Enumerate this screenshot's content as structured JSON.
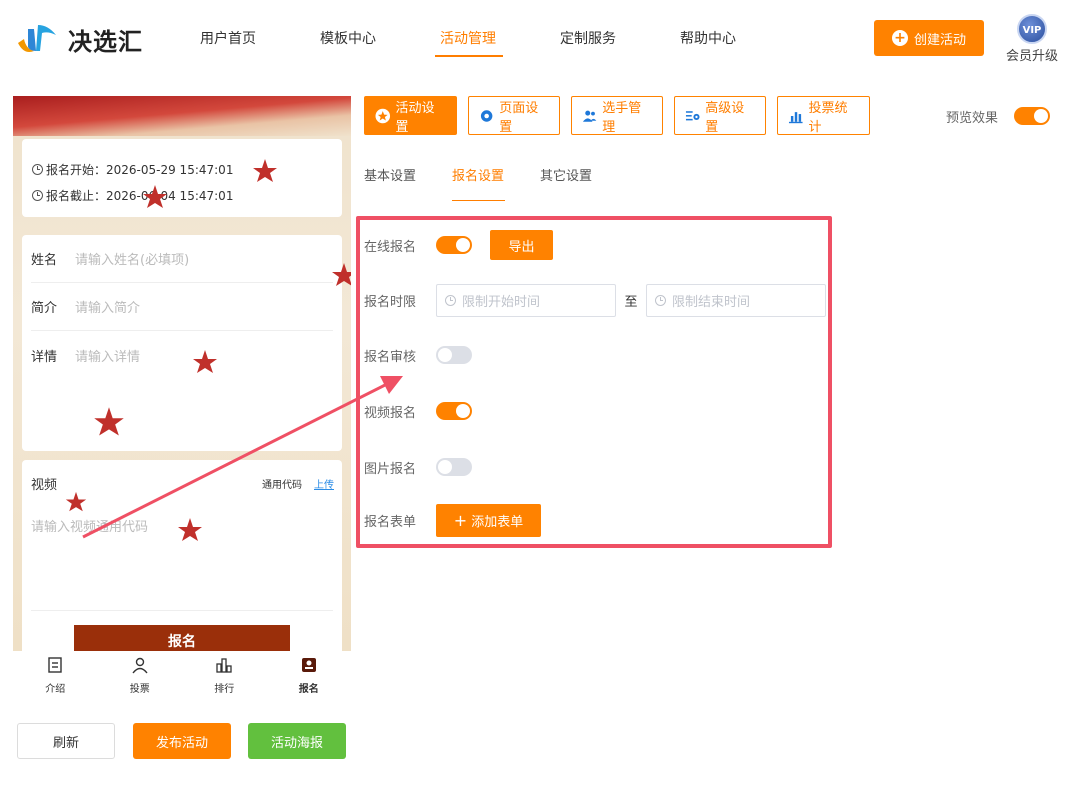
{
  "app": {
    "logo_text": "决选汇",
    "nav": [
      "用户首页",
      "模板中心",
      "活动管理",
      "定制服务",
      "帮助中心"
    ],
    "active_nav": "活动管理",
    "create_button": "创建活动",
    "vip_badge": "VIP",
    "vip_label": "会员升级"
  },
  "preview": {
    "times": {
      "start": "报名开始：2026-05-29 15:47:01",
      "end": "报名截止：2026-06-04 15:47:01"
    },
    "fields": [
      {
        "label": "姓名",
        "placeholder": "请输入姓名(必填项)"
      },
      {
        "label": "简介",
        "placeholder": "请输入简介"
      },
      {
        "label": "详情",
        "placeholder": "请输入详情"
      }
    ],
    "video": {
      "title": "视频",
      "code_label": "通用代码",
      "upload_label": "上传",
      "placeholder": "请输入视频通用代码"
    },
    "submit_label": "报名",
    "tabbar": [
      {
        "label": "介绍",
        "icon": "document-icon"
      },
      {
        "label": "投票",
        "icon": "user-icon"
      },
      {
        "label": "排行",
        "icon": "bar-chart-icon"
      },
      {
        "label": "报名",
        "icon": "signup-icon"
      }
    ],
    "active_tab": "报名"
  },
  "actions": {
    "refresh": "刷新",
    "publish": "发布活动",
    "poster": "活动海报"
  },
  "toolbar": [
    {
      "label": "活动设置",
      "icon": "star-circle-icon",
      "active": true
    },
    {
      "label": "页面设置",
      "icon": "gear-icon",
      "active": false
    },
    {
      "label": "选手管理",
      "icon": "users-icon",
      "active": false
    },
    {
      "label": "高级设置",
      "icon": "settings-list-icon",
      "active": false
    },
    {
      "label": "投票统计",
      "icon": "bar-chart-icon",
      "active": false
    }
  ],
  "preview_toggle": {
    "label": "预览效果",
    "on": true
  },
  "subtabs": [
    "基本设置",
    "报名设置",
    "其它设置"
  ],
  "active_subtab": "报名设置",
  "form": {
    "online_signup": {
      "label": "在线报名",
      "on": true,
      "export_label": "导出"
    },
    "signup_period": {
      "label": "报名时限",
      "start_placeholder": "限制开始时间",
      "separator": "至",
      "end_placeholder": "限制结束时间"
    },
    "signup_review": {
      "label": "报名审核",
      "on": false
    },
    "video_signup": {
      "label": "视频报名",
      "on": true
    },
    "image_signup": {
      "label": "图片报名",
      "on": false
    },
    "signup_form": {
      "label": "报名表单",
      "add_label": "添加表单"
    }
  },
  "colors": {
    "accent": "#ff8200",
    "highlight": "#ef5064",
    "poster_green": "#62c03e",
    "submit_brown": "#9a2f0a"
  }
}
